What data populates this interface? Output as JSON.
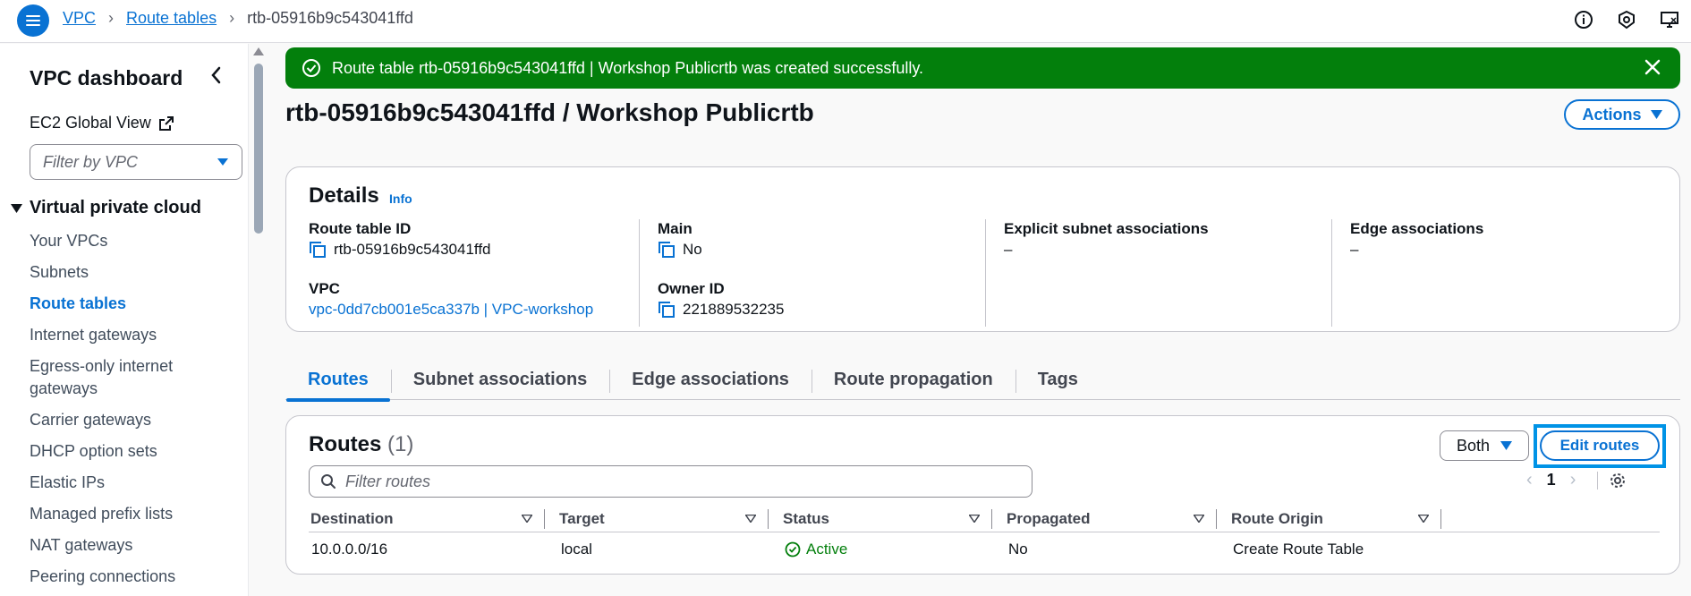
{
  "breadcrumb": {
    "items": [
      "VPC",
      "Route tables"
    ],
    "current": "rtb-05916b9c543041ffd"
  },
  "sidebar": {
    "title": "VPC dashboard",
    "ec2_link": "EC2 Global View",
    "filter_placeholder": "Filter by VPC",
    "section": "Virtual private cloud",
    "items": [
      "Your VPCs",
      "Subnets",
      "Route tables",
      "Internet gateways",
      "Egress-only internet gateways",
      "Carrier gateways",
      "DHCP option sets",
      "Elastic IPs",
      "Managed prefix lists",
      "NAT gateways",
      "Peering connections"
    ],
    "active_item": "Route tables"
  },
  "flash": {
    "message": "Route table rtb-05916b9c543041ffd | Workshop Publicrtb was created successfully."
  },
  "page": {
    "title": "rtb-05916b9c543041ffd / Workshop Publicrtb",
    "actions_label": "Actions"
  },
  "details": {
    "heading": "Details",
    "info_label": "Info",
    "route_table_id_label": "Route table ID",
    "route_table_id": "rtb-05916b9c543041ffd",
    "vpc_label": "VPC",
    "vpc_value": "vpc-0dd7cb001e5ca337b | VPC-workshop",
    "main_label": "Main",
    "main_value": "No",
    "owner_label": "Owner ID",
    "owner_value": "221889532235",
    "explicit_label": "Explicit subnet associations",
    "explicit_value": "–",
    "edge_label": "Edge associations",
    "edge_value": "–"
  },
  "tabs": [
    "Routes",
    "Subnet associations",
    "Edge associations",
    "Route propagation",
    "Tags"
  ],
  "routes": {
    "heading": "Routes",
    "count": "(1)",
    "filter_select": "Both",
    "edit_label": "Edit routes",
    "search_placeholder": "Filter routes",
    "page": "1",
    "columns": [
      "Destination",
      "Target",
      "Status",
      "Propagated",
      "Route Origin"
    ],
    "rows": [
      {
        "destination": "10.0.0.0/16",
        "target": "local",
        "status": "Active",
        "propagated": "No",
        "origin": "Create Route Table"
      }
    ]
  },
  "colors": {
    "accent": "#0972d3",
    "success": "#037f0c",
    "highlight": "#0093e6"
  }
}
